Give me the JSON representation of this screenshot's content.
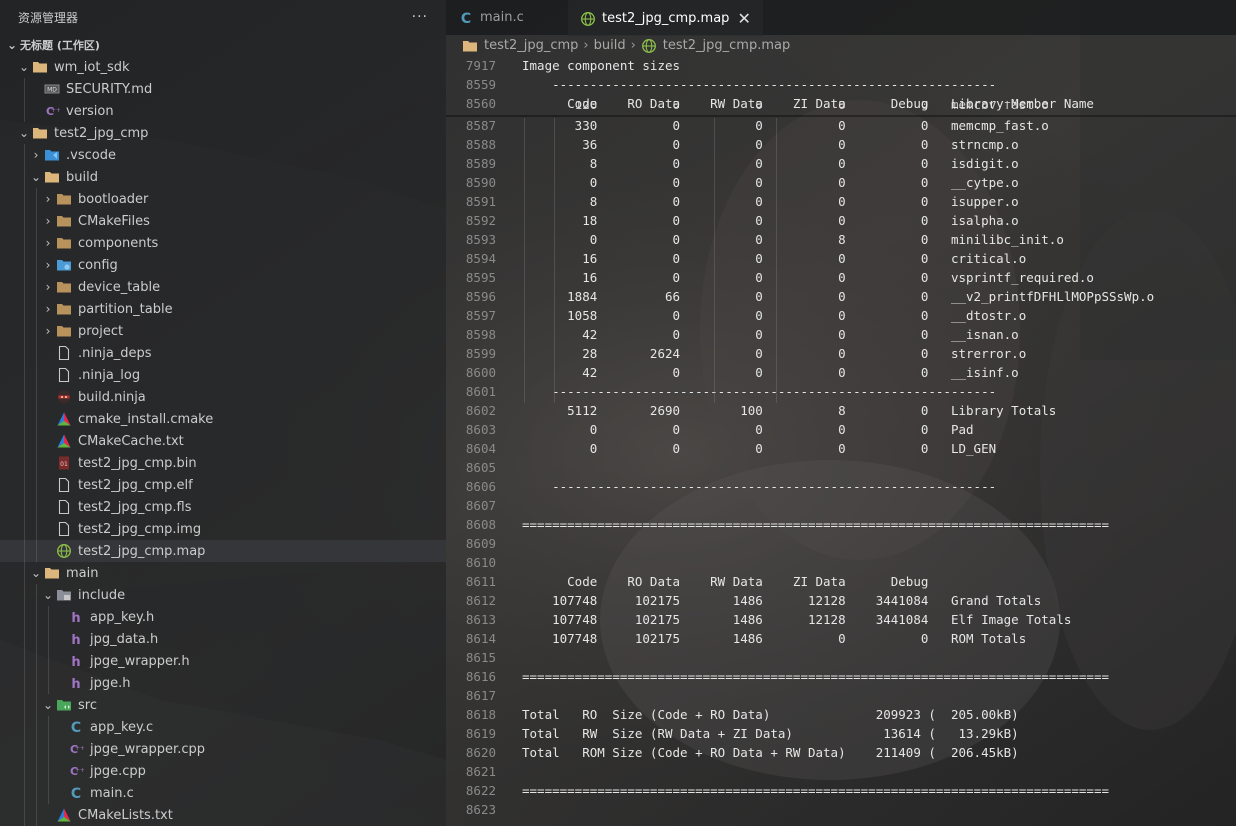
{
  "sidebar": {
    "title": "资源管理器",
    "more_label": "···",
    "workspace": "无标题 (工作区)",
    "tree": [
      {
        "label": "wm_iot_sdk",
        "depth": 1,
        "chev": "down",
        "icon": "folder-open-icon"
      },
      {
        "label": "SECURITY.md",
        "depth": 2,
        "chev": "none",
        "icon": "markdown-file-icon"
      },
      {
        "label": "version",
        "depth": 2,
        "chev": "none",
        "icon": "cpp-file-icon"
      },
      {
        "label": "test2_jpg_cmp",
        "depth": 1,
        "chev": "down",
        "icon": "folder-open-icon"
      },
      {
        "label": ".vscode",
        "depth": 2,
        "chev": "right",
        "icon": "vscode-folder-icon"
      },
      {
        "label": "build",
        "depth": 2,
        "chev": "down",
        "icon": "folder-open-icon"
      },
      {
        "label": "bootloader",
        "depth": 3,
        "chev": "right",
        "icon": "folder-icon"
      },
      {
        "label": "CMakeFiles",
        "depth": 3,
        "chev": "right",
        "icon": "folder-icon"
      },
      {
        "label": "components",
        "depth": 3,
        "chev": "right",
        "icon": "folder-icon"
      },
      {
        "label": "config",
        "depth": 3,
        "chev": "right",
        "icon": "config-folder-icon"
      },
      {
        "label": "device_table",
        "depth": 3,
        "chev": "right",
        "icon": "folder-icon"
      },
      {
        "label": "partition_table",
        "depth": 3,
        "chev": "right",
        "icon": "folder-icon"
      },
      {
        "label": "project",
        "depth": 3,
        "chev": "right",
        "icon": "folder-icon"
      },
      {
        "label": ".ninja_deps",
        "depth": 3,
        "chev": "none",
        "icon": "file-icon"
      },
      {
        "label": ".ninja_log",
        "depth": 3,
        "chev": "none",
        "icon": "file-icon"
      },
      {
        "label": "build.ninja",
        "depth": 3,
        "chev": "none",
        "icon": "ninja-file-icon"
      },
      {
        "label": "cmake_install.cmake",
        "depth": 3,
        "chev": "none",
        "icon": "cmake-icon"
      },
      {
        "label": "CMakeCache.txt",
        "depth": 3,
        "chev": "none",
        "icon": "cmake-icon"
      },
      {
        "label": "test2_jpg_cmp.bin",
        "depth": 3,
        "chev": "none",
        "icon": "binary-file-icon"
      },
      {
        "label": "test2_jpg_cmp.elf",
        "depth": 3,
        "chev": "none",
        "icon": "file-icon"
      },
      {
        "label": "test2_jpg_cmp.fls",
        "depth": 3,
        "chev": "none",
        "icon": "file-icon"
      },
      {
        "label": "test2_jpg_cmp.img",
        "depth": 3,
        "chev": "none",
        "icon": "file-icon"
      },
      {
        "label": "test2_jpg_cmp.map",
        "depth": 3,
        "chev": "none",
        "icon": "globe-icon",
        "selected": true
      },
      {
        "label": "main",
        "depth": 2,
        "chev": "down",
        "icon": "folder-open-icon"
      },
      {
        "label": "include",
        "depth": 3,
        "chev": "down",
        "icon": "include-folder-icon"
      },
      {
        "label": "app_key.h",
        "depth": 4,
        "chev": "none",
        "icon": "header-file-icon"
      },
      {
        "label": "jpg_data.h",
        "depth": 4,
        "chev": "none",
        "icon": "header-file-icon"
      },
      {
        "label": "jpge_wrapper.h",
        "depth": 4,
        "chev": "none",
        "icon": "header-file-icon"
      },
      {
        "label": "jpge.h",
        "depth": 4,
        "chev": "none",
        "icon": "header-file-icon"
      },
      {
        "label": "src",
        "depth": 3,
        "chev": "down",
        "icon": "src-folder-icon"
      },
      {
        "label": "app_key.c",
        "depth": 4,
        "chev": "none",
        "icon": "c-file-icon"
      },
      {
        "label": "jpge_wrapper.cpp",
        "depth": 4,
        "chev": "none",
        "icon": "cpp-file-icon"
      },
      {
        "label": "jpge.cpp",
        "depth": 4,
        "chev": "none",
        "icon": "cpp-file-icon"
      },
      {
        "label": "main.c",
        "depth": 4,
        "chev": "none",
        "icon": "c-file-icon"
      },
      {
        "label": "CMakeLists.txt",
        "depth": 3,
        "chev": "none",
        "icon": "cmake-icon"
      }
    ]
  },
  "editor": {
    "tabs": [
      {
        "label": "main.c",
        "icon": "c-file-icon",
        "active": false
      },
      {
        "label": "test2_jpg_cmp.map",
        "icon": "globe-icon",
        "active": true,
        "close": "✕"
      }
    ],
    "breadcrumb": [
      {
        "label": "test2_jpg_cmp",
        "icon": "folder-icon"
      },
      {
        "label": "build",
        "icon": ""
      },
      {
        "label": "test2_jpg_cmp.map",
        "icon": "globe-icon"
      }
    ],
    "sticky_lines": [
      {
        "num": "7917",
        "text": "Image component sizes"
      },
      {
        "num": "8559",
        "text": "    -----------------------------------------------------------"
      },
      {
        "num": "8560",
        "text": "      Code    RO Data    RW Data    ZI Data      Debug   Library Member Name"
      }
    ],
    "lines": [
      {
        "num": "8587",
        "text": "       330          0          0          0          0   memcmp_fast.o"
      },
      {
        "num": "8588",
        "text": "        36          0          0          0          0   strncmp.o"
      },
      {
        "num": "8589",
        "text": "         8          0          0          0          0   isdigit.o"
      },
      {
        "num": "8590",
        "text": "         0          0          0          0          0   __cytpe.o"
      },
      {
        "num": "8591",
        "text": "         8          0          0          0          0   isupper.o"
      },
      {
        "num": "8592",
        "text": "        18          0          0          0          0   isalpha.o"
      },
      {
        "num": "8593",
        "text": "         0          0          0          8          0   minilibc_init.o"
      },
      {
        "num": "8594",
        "text": "        16          0          0          0          0   critical.o"
      },
      {
        "num": "8595",
        "text": "        16          0          0          0          0   vsprintf_required.o"
      },
      {
        "num": "8596",
        "text": "      1884         66          0          0          0   __v2_printfDFHLlMOPpSSsWp.o"
      },
      {
        "num": "8597",
        "text": "      1058          0          0          0          0   __dtostr.o"
      },
      {
        "num": "8598",
        "text": "        42          0          0          0          0   __isnan.o"
      },
      {
        "num": "8599",
        "text": "        28       2624          0          0          0   strerror.o"
      },
      {
        "num": "8600",
        "text": "        42          0          0          0          0   __isinf.o"
      },
      {
        "num": "8601",
        "text": "    -----------------------------------------------------------"
      },
      {
        "num": "8602",
        "text": "      5112       2690        100          8          0   Library Totals"
      },
      {
        "num": "8603",
        "text": "         0          0          0          0          0   Pad"
      },
      {
        "num": "8604",
        "text": "         0          0          0          0          0   LD_GEN"
      },
      {
        "num": "8605",
        "text": ""
      },
      {
        "num": "8606",
        "text": "    -----------------------------------------------------------"
      },
      {
        "num": "8607",
        "text": ""
      },
      {
        "num": "8608",
        "text": "=============================================================================="
      },
      {
        "num": "8609",
        "text": ""
      },
      {
        "num": "8610",
        "text": ""
      },
      {
        "num": "8611",
        "text": "      Code    RO Data    RW Data    ZI Data      Debug"
      },
      {
        "num": "8612",
        "text": "    107748     102175       1486      12128    3441084   Grand Totals"
      },
      {
        "num": "8613",
        "text": "    107748     102175       1486      12128    3441084   Elf Image Totals"
      },
      {
        "num": "8614",
        "text": "    107748     102175       1486          0          0   ROM Totals"
      },
      {
        "num": "8615",
        "text": ""
      },
      {
        "num": "8616",
        "text": "=============================================================================="
      },
      {
        "num": "8617",
        "text": ""
      },
      {
        "num": "8618",
        "text": "Total   RO  Size (Code + RO Data)              209923 (  205.00kB)"
      },
      {
        "num": "8619",
        "text": "Total   RW  Size (RW Data + ZI Data)            13614 (   13.29kB)"
      },
      {
        "num": "8620",
        "text": "Total   ROM Size (Code + RO Data + RW Data)    211409 (  206.45kB)"
      },
      {
        "num": "8621",
        "text": ""
      },
      {
        "num": "8622",
        "text": "=============================================================================="
      },
      {
        "num": "8623",
        "text": ""
      }
    ],
    "partial_line": {
      "num": "8586",
      "text": "       120          0          0          0          0   memcpy_fast.o"
    }
  },
  "colors": {
    "c_icon": "#519aba",
    "h_icon": "#a074c4",
    "cpp_icon": "#a074c4",
    "folder": "#dcb67a",
    "globe": "#8dc149",
    "cmake": "#e8274b"
  }
}
